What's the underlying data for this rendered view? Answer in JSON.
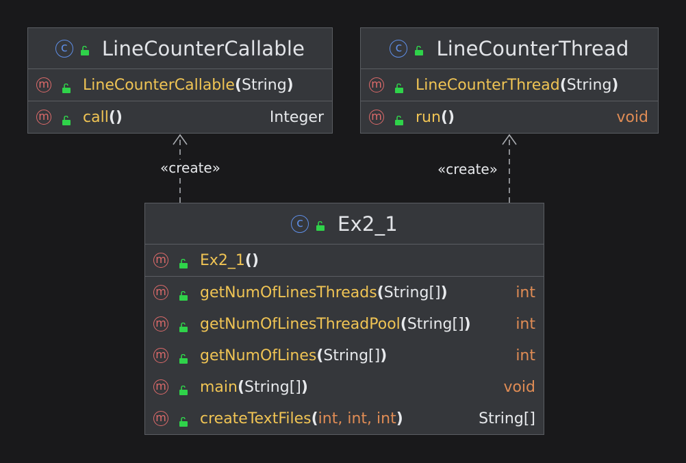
{
  "classes": {
    "callable": {
      "name": "LineCounterCallable",
      "methods": [
        {
          "name": "LineCounterCallable",
          "params": [
            {
              "text": "String",
              "primitive": false
            }
          ],
          "return": ""
        },
        {
          "name": "call",
          "params": [],
          "return": "Integer",
          "return_primitive": false
        }
      ]
    },
    "thread": {
      "name": "LineCounterThread",
      "methods": [
        {
          "name": "LineCounterThread",
          "params": [
            {
              "text": "String",
              "primitive": false
            }
          ],
          "return": ""
        },
        {
          "name": "run",
          "params": [],
          "return": "void",
          "return_primitive": true
        }
      ]
    },
    "ex21": {
      "name": "Ex2_1",
      "methods": [
        {
          "name": "Ex2_1",
          "params": [],
          "return": ""
        },
        {
          "name": "getNumOfLinesThreads",
          "params": [
            {
              "text": "String[]",
              "primitive": false
            }
          ],
          "return": "int",
          "return_primitive": true
        },
        {
          "name": "getNumOfLinesThreadPool",
          "params": [
            {
              "text": "String[]",
              "primitive": false
            }
          ],
          "return": "int",
          "return_primitive": true
        },
        {
          "name": "getNumOfLines",
          "params": [
            {
              "text": "String[]",
              "primitive": false
            }
          ],
          "return": "int",
          "return_primitive": true
        },
        {
          "name": "main",
          "params": [
            {
              "text": "String[]",
              "primitive": false
            }
          ],
          "return": "void",
          "return_primitive": true
        },
        {
          "name": "createTextFiles",
          "params": [
            {
              "text": "int",
              "primitive": true
            },
            {
              "text": "int",
              "primitive": true
            },
            {
              "text": "int",
              "primitive": true
            }
          ],
          "return": "String[]",
          "return_primitive": false
        }
      ]
    }
  },
  "relations": {
    "create_label": "«create»"
  },
  "icons": {
    "class_icon_glyph": "c",
    "method_icon_glyph": "m",
    "public_lock": "unlocked-lock-icon"
  },
  "colors": {
    "background": "#19191b",
    "box_fill": "#35373b",
    "box_border": "#5b5e63",
    "method_name": "#f0c454",
    "primitive_type": "#e08c55",
    "class_icon": "#5f8fe8",
    "method_icon": "#e06b6b",
    "lock": "#2fd34a"
  }
}
